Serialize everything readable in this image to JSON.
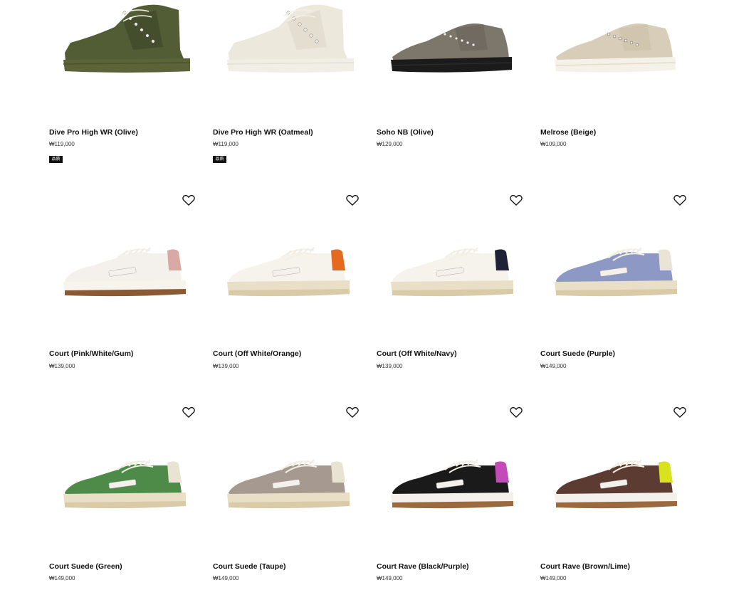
{
  "products": [
    {
      "name": "Dive Pro High WR (Olive)",
      "price": "₩119,000",
      "badge": "品质",
      "heart": false,
      "style": "high",
      "upper": "#525c35",
      "accent": "#3e4526",
      "sole": "#5c6338",
      "stripe": "#4a5230"
    },
    {
      "name": "Dive Pro High WR (Oatmeal)",
      "price": "₩119,000",
      "badge": "品质",
      "heart": false,
      "style": "high",
      "upper": "#ece8dc",
      "accent": "#ddd7c8",
      "sole": "#f1eee6",
      "stripe": "#e3dfd2"
    },
    {
      "name": "Soho NB (Olive)",
      "price": "₩129,000",
      "badge": "",
      "heart": false,
      "style": "low",
      "upper": "#7d776b",
      "accent": "#67625a",
      "sole": "#1b1b1b",
      "stripe": "#2a2a2a"
    },
    {
      "name": "Melrose (Beige)",
      "price": "₩109,000",
      "badge": "",
      "heart": false,
      "style": "low",
      "upper": "#d8cdb8",
      "accent": "#cbbfa8",
      "sole": "#f4f1e8",
      "stripe": "#e4dccb"
    },
    {
      "name": "Court (Pink/White/Gum)",
      "price": "₩139,000",
      "badge": "",
      "heart": true,
      "style": "court",
      "upper": "#f4f1ec",
      "accent": "#d9a9a4",
      "sole": "#f7f4ee",
      "stripe": "#8b5a34"
    },
    {
      "name": "Court (Off White/Orange)",
      "price": "₩139,000",
      "badge": "",
      "heart": true,
      "style": "court",
      "upper": "#f6f3ec",
      "accent": "#e36a1e",
      "sole": "#e9dfc6",
      "stripe": "#d9cba8"
    },
    {
      "name": "Court (Off White/Navy)",
      "price": "₩139,000",
      "badge": "",
      "heart": true,
      "style": "court",
      "upper": "#f6f3ec",
      "accent": "#1d2236",
      "sole": "#e9dfc6",
      "stripe": "#d9cba8"
    },
    {
      "name": "Court Suede (Purple)",
      "price": "₩149,000",
      "badge": "",
      "heart": true,
      "style": "court",
      "upper": "#8d98c5",
      "accent": "#eae4d6",
      "sole": "#e9dfc6",
      "stripe": "#d9cba8"
    },
    {
      "name": "Court Suede (Green)",
      "price": "₩149,000",
      "badge": "",
      "heart": true,
      "style": "court",
      "upper": "#4e8a48",
      "accent": "#e9e3d3",
      "sole": "#e9dfc6",
      "stripe": "#d9cba8"
    },
    {
      "name": "Court Suede (Taupe)",
      "price": "₩149,000",
      "badge": "",
      "heart": true,
      "style": "court",
      "upper": "#a69a90",
      "accent": "#e9e3d3",
      "sole": "#e9dfc6",
      "stripe": "#d9cba8"
    },
    {
      "name": "Court Rave (Black/Purple)",
      "price": "₩149,000",
      "badge": "",
      "heart": true,
      "style": "court",
      "upper": "#1a1a1a",
      "accent": "#c44ab8",
      "sole": "#f4f1ec",
      "stripe": "#9a6a3e"
    },
    {
      "name": "Court Rave (Brown/Lime)",
      "price": "₩149,000",
      "badge": "",
      "heart": true,
      "style": "court",
      "upper": "#5b3b32",
      "accent": "#d8e21f",
      "sole": "#f4f1ec",
      "stripe": "#9a6a3e"
    }
  ]
}
